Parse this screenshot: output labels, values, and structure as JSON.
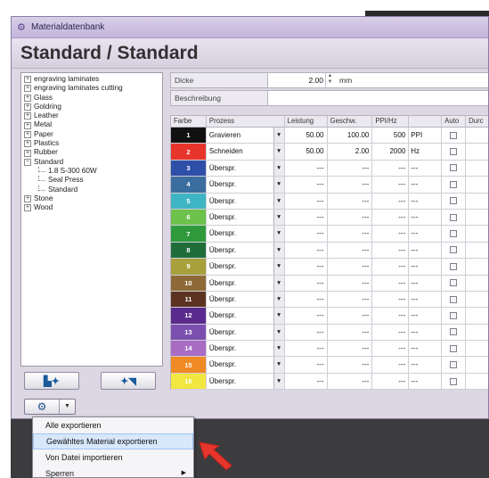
{
  "window": {
    "title": "Materialdatenbank"
  },
  "header": {
    "title": "Standard / Standard"
  },
  "tree": {
    "items": [
      {
        "label": "engraving laminates",
        "level": 0,
        "expander": "+"
      },
      {
        "label": "engraving laminates cutting",
        "level": 0,
        "expander": "+"
      },
      {
        "label": "Glass",
        "level": 0,
        "expander": "+"
      },
      {
        "label": "Goldring",
        "level": 0,
        "expander": "+"
      },
      {
        "label": "Leather",
        "level": 0,
        "expander": "+"
      },
      {
        "label": "Metal",
        "level": 0,
        "expander": "+"
      },
      {
        "label": "Paper",
        "level": 0,
        "expander": "+"
      },
      {
        "label": "Plastics",
        "level": 0,
        "expander": "+"
      },
      {
        "label": "Rubber",
        "level": 0,
        "expander": "+"
      },
      {
        "label": "Standard",
        "level": 0,
        "expander": "−"
      },
      {
        "label": "1.8 S-300 60W",
        "level": 1,
        "expander": ""
      },
      {
        "label": "Seal Press",
        "level": 1,
        "expander": ""
      },
      {
        "label": "Standard",
        "level": 1,
        "expander": ""
      },
      {
        "label": "Stone",
        "level": 0,
        "expander": "+"
      },
      {
        "label": "Wood",
        "level": 0,
        "expander": "+"
      }
    ]
  },
  "properties": {
    "dicke_label": "Dicke",
    "dicke_value": "2.00",
    "dicke_unit": "mm",
    "beschreibung_label": "Beschreibung",
    "beschreibung_value": ""
  },
  "table": {
    "headers": [
      "Farbe",
      "Prozess",
      "Leistung",
      "Geschw.",
      "PPI/Hz",
      "",
      "Auto",
      "Durc"
    ],
    "rows": [
      {
        "num": "1",
        "color": "#111111",
        "process": "Gravieren",
        "leistung": "50.00",
        "geschw": "100.00",
        "ppi": "500",
        "unit": "PPI"
      },
      {
        "num": "2",
        "color": "#e8352c",
        "process": "Schneiden",
        "leistung": "50.00",
        "geschw": "2.00",
        "ppi": "2000",
        "unit": "Hz"
      },
      {
        "num": "3",
        "color": "#2e4fa8",
        "process": "Überspr.",
        "leistung": "---",
        "geschw": "---",
        "ppi": "---",
        "unit": "---"
      },
      {
        "num": "4",
        "color": "#3b6e9e",
        "process": "Überspr.",
        "leistung": "---",
        "geschw": "---",
        "ppi": "---",
        "unit": "---"
      },
      {
        "num": "5",
        "color": "#3fb5c4",
        "process": "Überspr.",
        "leistung": "---",
        "geschw": "---",
        "ppi": "---",
        "unit": "---"
      },
      {
        "num": "6",
        "color": "#6cc24a",
        "process": "Überspr.",
        "leistung": "---",
        "geschw": "---",
        "ppi": "---",
        "unit": "---"
      },
      {
        "num": "7",
        "color": "#2f9a3c",
        "process": "Überspr.",
        "leistung": "---",
        "geschw": "---",
        "ppi": "---",
        "unit": "---"
      },
      {
        "num": "8",
        "color": "#1f6e3a",
        "process": "Überspr.",
        "leistung": "---",
        "geschw": "---",
        "ppi": "---",
        "unit": "---"
      },
      {
        "num": "9",
        "color": "#a8a03a",
        "process": "Überspr.",
        "leistung": "---",
        "geschw": "---",
        "ppi": "---",
        "unit": "---"
      },
      {
        "num": "10",
        "color": "#8e6a38",
        "process": "Überspr.",
        "leistung": "---",
        "geschw": "---",
        "ppi": "---",
        "unit": "---"
      },
      {
        "num": "11",
        "color": "#5c3320",
        "process": "Überspr.",
        "leistung": "---",
        "geschw": "---",
        "ppi": "---",
        "unit": "---"
      },
      {
        "num": "12",
        "color": "#5a2a8e",
        "process": "Überspr.",
        "leistung": "---",
        "geschw": "---",
        "ppi": "---",
        "unit": "---"
      },
      {
        "num": "13",
        "color": "#7b4fb0",
        "process": "Überspr.",
        "leistung": "---",
        "geschw": "---",
        "ppi": "---",
        "unit": "---"
      },
      {
        "num": "14",
        "color": "#a86cc4",
        "process": "Überspr.",
        "leistung": "---",
        "geschw": "---",
        "ppi": "---",
        "unit": "---"
      },
      {
        "num": "15",
        "color": "#f08a24",
        "process": "Überspr.",
        "leistung": "---",
        "geschw": "---",
        "ppi": "---",
        "unit": "---"
      },
      {
        "num": "16",
        "color": "#f2e640",
        "process": "Überspr.",
        "leistung": "---",
        "geschw": "---",
        "ppi": "---",
        "unit": "---"
      }
    ]
  },
  "buttons": {
    "tree_left_icon": "add-folder-icon",
    "tree_right_icon": "add-item-icon",
    "settings_icon": "gear-icon"
  },
  "menu": {
    "items": [
      {
        "label": "Alle exportieren",
        "selected": false
      },
      {
        "label": "Gewähltes Material exportieren",
        "selected": true
      },
      {
        "label": "Von Datei importieren",
        "selected": false
      },
      {
        "label": "Sperren",
        "selected": false,
        "submenu": true
      }
    ]
  },
  "colors": {
    "window_border": "#8b7da8",
    "annotation_arrow": "#e8352c"
  }
}
